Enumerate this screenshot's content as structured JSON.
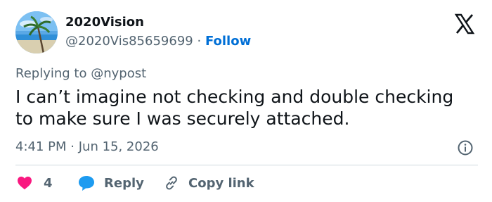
{
  "user": {
    "display_name": "2020Vision",
    "handle": "@2020Vis85659699",
    "separator": "·",
    "follow_label": "Follow"
  },
  "reply": {
    "prefix": "Replying to",
    "target": "@nypost"
  },
  "tweet": {
    "lines": [
      "I can’t imagine not checking and double checking",
      "to make sure I was securely attached."
    ]
  },
  "meta": {
    "time": "4:41 PM",
    "separator": "·",
    "date": "Jun 15, 2026"
  },
  "actions": {
    "like_count": "4",
    "reply_label": "Reply",
    "copy_label": "Copy link"
  },
  "icons": {
    "avatar": "palm-beach-avatar",
    "logo": "x-logo-icon",
    "info": "info-icon",
    "like": "heart-icon",
    "reply": "speech-bubble-icon",
    "copy": "link-icon"
  },
  "colors": {
    "text": "#0f1419",
    "secondary": "#536471",
    "link": "#006fd6",
    "like": "#f91880",
    "reply": "#1d9bf0",
    "divider": "#cfd9de"
  }
}
